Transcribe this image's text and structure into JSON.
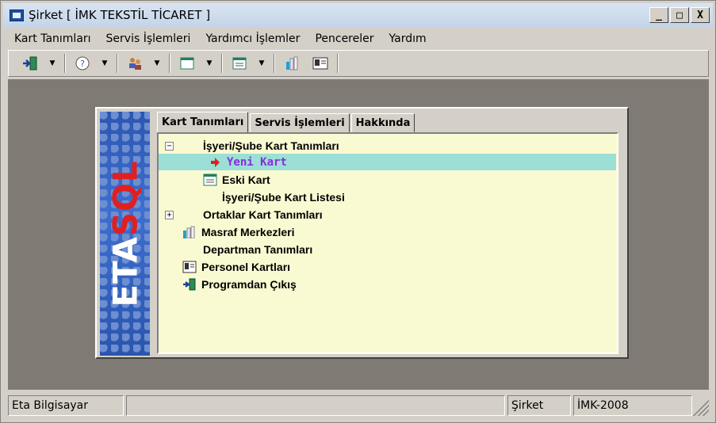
{
  "window": {
    "title": "Şirket [ İMK TEKSTİL TİCARET ]",
    "buttons": {
      "minimize": "_",
      "maximize": "□",
      "close": "X"
    }
  },
  "menu": [
    {
      "label": "Kart Tanımları"
    },
    {
      "label": "Servis İşlemleri"
    },
    {
      "label": "Yardımcı İşlemler"
    },
    {
      "label": "Pencereler"
    },
    {
      "label": "Yardım"
    }
  ],
  "toolbar": {
    "icons": [
      "exit-icon",
      "help-icon",
      "users-icon",
      "window-icon",
      "form-icon",
      "cost-center-icon",
      "personnel-icon"
    ],
    "dropdown_arrow": "▼"
  },
  "panel": {
    "logo": {
      "brand": "ETA",
      "brand_accent": "SQL"
    },
    "tabs": [
      {
        "label": "Kart Tanımları",
        "active": true
      },
      {
        "label": "Servis İşlemleri",
        "active": false
      },
      {
        "label": "Hakkında",
        "active": false
      }
    ],
    "tree": {
      "expander_collapse": "−",
      "expander_expand": "+",
      "nodes": [
        {
          "label": "İşyeri/Şube Kart Tanımları"
        },
        {
          "label": "Yeni Kart",
          "selected": true
        },
        {
          "label": "Eski Kart"
        },
        {
          "label": "İşyeri/Şube Kart Listesi"
        },
        {
          "label": "Ortaklar Kart Tanımları"
        },
        {
          "label": "Masraf Merkezleri"
        },
        {
          "label": "Departman Tanımları"
        },
        {
          "label": "Personel Kartları"
        },
        {
          "label": "Programdan Çıkış"
        }
      ]
    }
  },
  "statusbar": {
    "company": "Eta Bilgisayar",
    "middle": "",
    "module": "Şirket",
    "database": "İMK-2008"
  },
  "colors": {
    "tree_background": "#fafad2",
    "selection": "#9cdfd6",
    "selected_text": "#8a2be2",
    "desktop": "#807a74",
    "arrow": "#e02020"
  }
}
